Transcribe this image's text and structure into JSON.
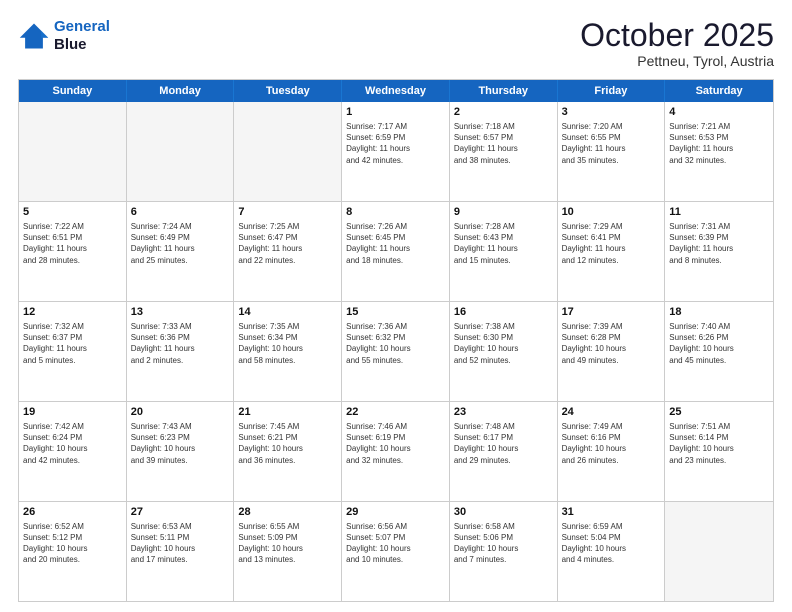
{
  "logo": {
    "line1": "General",
    "line2": "Blue"
  },
  "header": {
    "month": "October 2025",
    "location": "Pettneu, Tyrol, Austria"
  },
  "weekdays": [
    "Sunday",
    "Monday",
    "Tuesday",
    "Wednesday",
    "Thursday",
    "Friday",
    "Saturday"
  ],
  "rows": [
    [
      {
        "day": "",
        "info": "",
        "empty": true
      },
      {
        "day": "",
        "info": "",
        "empty": true
      },
      {
        "day": "",
        "info": "",
        "empty": true
      },
      {
        "day": "1",
        "info": "Sunrise: 7:17 AM\nSunset: 6:59 PM\nDaylight: 11 hours\nand 42 minutes.",
        "empty": false
      },
      {
        "day": "2",
        "info": "Sunrise: 7:18 AM\nSunset: 6:57 PM\nDaylight: 11 hours\nand 38 minutes.",
        "empty": false
      },
      {
        "day": "3",
        "info": "Sunrise: 7:20 AM\nSunset: 6:55 PM\nDaylight: 11 hours\nand 35 minutes.",
        "empty": false
      },
      {
        "day": "4",
        "info": "Sunrise: 7:21 AM\nSunset: 6:53 PM\nDaylight: 11 hours\nand 32 minutes.",
        "empty": false
      }
    ],
    [
      {
        "day": "5",
        "info": "Sunrise: 7:22 AM\nSunset: 6:51 PM\nDaylight: 11 hours\nand 28 minutes.",
        "empty": false
      },
      {
        "day": "6",
        "info": "Sunrise: 7:24 AM\nSunset: 6:49 PM\nDaylight: 11 hours\nand 25 minutes.",
        "empty": false
      },
      {
        "day": "7",
        "info": "Sunrise: 7:25 AM\nSunset: 6:47 PM\nDaylight: 11 hours\nand 22 minutes.",
        "empty": false
      },
      {
        "day": "8",
        "info": "Sunrise: 7:26 AM\nSunset: 6:45 PM\nDaylight: 11 hours\nand 18 minutes.",
        "empty": false
      },
      {
        "day": "9",
        "info": "Sunrise: 7:28 AM\nSunset: 6:43 PM\nDaylight: 11 hours\nand 15 minutes.",
        "empty": false
      },
      {
        "day": "10",
        "info": "Sunrise: 7:29 AM\nSunset: 6:41 PM\nDaylight: 11 hours\nand 12 minutes.",
        "empty": false
      },
      {
        "day": "11",
        "info": "Sunrise: 7:31 AM\nSunset: 6:39 PM\nDaylight: 11 hours\nand 8 minutes.",
        "empty": false
      }
    ],
    [
      {
        "day": "12",
        "info": "Sunrise: 7:32 AM\nSunset: 6:37 PM\nDaylight: 11 hours\nand 5 minutes.",
        "empty": false
      },
      {
        "day": "13",
        "info": "Sunrise: 7:33 AM\nSunset: 6:36 PM\nDaylight: 11 hours\nand 2 minutes.",
        "empty": false
      },
      {
        "day": "14",
        "info": "Sunrise: 7:35 AM\nSunset: 6:34 PM\nDaylight: 10 hours\nand 58 minutes.",
        "empty": false
      },
      {
        "day": "15",
        "info": "Sunrise: 7:36 AM\nSunset: 6:32 PM\nDaylight: 10 hours\nand 55 minutes.",
        "empty": false
      },
      {
        "day": "16",
        "info": "Sunrise: 7:38 AM\nSunset: 6:30 PM\nDaylight: 10 hours\nand 52 minutes.",
        "empty": false
      },
      {
        "day": "17",
        "info": "Sunrise: 7:39 AM\nSunset: 6:28 PM\nDaylight: 10 hours\nand 49 minutes.",
        "empty": false
      },
      {
        "day": "18",
        "info": "Sunrise: 7:40 AM\nSunset: 6:26 PM\nDaylight: 10 hours\nand 45 minutes.",
        "empty": false
      }
    ],
    [
      {
        "day": "19",
        "info": "Sunrise: 7:42 AM\nSunset: 6:24 PM\nDaylight: 10 hours\nand 42 minutes.",
        "empty": false
      },
      {
        "day": "20",
        "info": "Sunrise: 7:43 AM\nSunset: 6:23 PM\nDaylight: 10 hours\nand 39 minutes.",
        "empty": false
      },
      {
        "day": "21",
        "info": "Sunrise: 7:45 AM\nSunset: 6:21 PM\nDaylight: 10 hours\nand 36 minutes.",
        "empty": false
      },
      {
        "day": "22",
        "info": "Sunrise: 7:46 AM\nSunset: 6:19 PM\nDaylight: 10 hours\nand 32 minutes.",
        "empty": false
      },
      {
        "day": "23",
        "info": "Sunrise: 7:48 AM\nSunset: 6:17 PM\nDaylight: 10 hours\nand 29 minutes.",
        "empty": false
      },
      {
        "day": "24",
        "info": "Sunrise: 7:49 AM\nSunset: 6:16 PM\nDaylight: 10 hours\nand 26 minutes.",
        "empty": false
      },
      {
        "day": "25",
        "info": "Sunrise: 7:51 AM\nSunset: 6:14 PM\nDaylight: 10 hours\nand 23 minutes.",
        "empty": false
      }
    ],
    [
      {
        "day": "26",
        "info": "Sunrise: 6:52 AM\nSunset: 5:12 PM\nDaylight: 10 hours\nand 20 minutes.",
        "empty": false
      },
      {
        "day": "27",
        "info": "Sunrise: 6:53 AM\nSunset: 5:11 PM\nDaylight: 10 hours\nand 17 minutes.",
        "empty": false
      },
      {
        "day": "28",
        "info": "Sunrise: 6:55 AM\nSunset: 5:09 PM\nDaylight: 10 hours\nand 13 minutes.",
        "empty": false
      },
      {
        "day": "29",
        "info": "Sunrise: 6:56 AM\nSunset: 5:07 PM\nDaylight: 10 hours\nand 10 minutes.",
        "empty": false
      },
      {
        "day": "30",
        "info": "Sunrise: 6:58 AM\nSunset: 5:06 PM\nDaylight: 10 hours\nand 7 minutes.",
        "empty": false
      },
      {
        "day": "31",
        "info": "Sunrise: 6:59 AM\nSunset: 5:04 PM\nDaylight: 10 hours\nand 4 minutes.",
        "empty": false
      },
      {
        "day": "",
        "info": "",
        "empty": true
      }
    ]
  ]
}
